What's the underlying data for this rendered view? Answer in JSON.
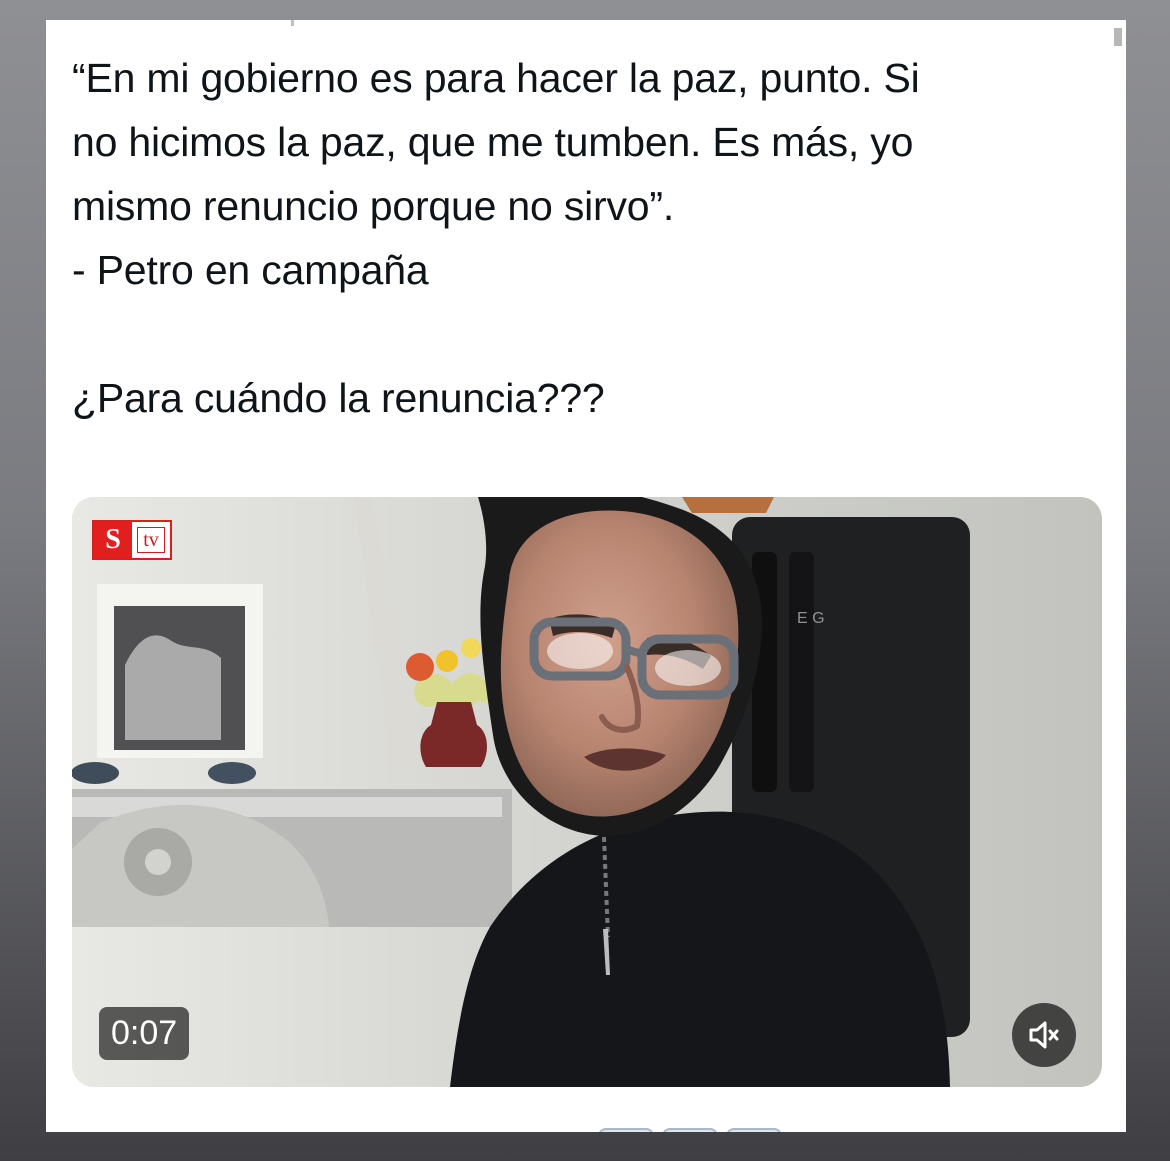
{
  "tweet": {
    "quote_line1": "“En mi gobierno es para hacer la paz, punto. Si",
    "quote_line2": "no hicimos la paz, que me tumben. Es más, yo",
    "quote_line3": "mismo renuncio porque no sirvo”.",
    "attribution": "- Petro en campaña",
    "question": "¿Para cuándo la renuncia???"
  },
  "video": {
    "badge_s": "S",
    "badge_tv": "tv",
    "duration": "0:07",
    "fridge_letters": "E  G",
    "mute_icon": "muted-speaker-icon"
  },
  "colors": {
    "text": "#0f1419",
    "badge_red": "#e11f1f",
    "overlay": "#000000"
  }
}
